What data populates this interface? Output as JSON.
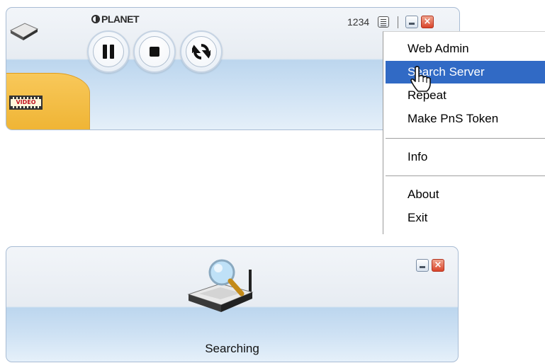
{
  "player": {
    "brand": "PLANET",
    "user_id": "1234",
    "video_label": "VIDEO",
    "controls": [
      "pause-icon",
      "stop-icon",
      "refresh-icon"
    ]
  },
  "context_menu": {
    "items": [
      {
        "label": "Web Admin"
      },
      {
        "label": "Search Server",
        "highlighted": true
      },
      {
        "label": "Repeat"
      },
      {
        "label": "Make PnS Token"
      },
      {
        "label": "Info"
      },
      {
        "label": "About"
      },
      {
        "label": "Exit"
      }
    ]
  },
  "search_window": {
    "status": "Searching",
    "icon": "router-search-icon"
  },
  "colors": {
    "menu_highlight": "#316ac5",
    "video_tab": "#f2b93a",
    "window_bg": "#e7ecf2",
    "close_button": "#d9442a"
  }
}
